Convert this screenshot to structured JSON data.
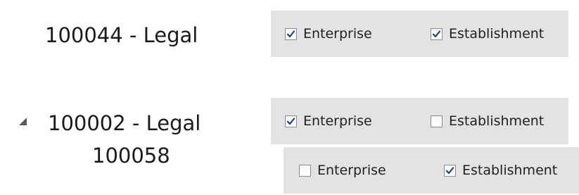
{
  "rows": [
    {
      "label": "100044 - Legal",
      "enterprise": {
        "label": "Enterprise",
        "checked": true
      },
      "establishment": {
        "label": "Establishment",
        "checked": true
      }
    },
    {
      "label": "100002 - Legal",
      "expander": "collapse-triangle-icon",
      "enterprise": {
        "label": "Enterprise",
        "checked": true
      },
      "establishment": {
        "label": "Establishment",
        "checked": false
      }
    },
    {
      "label": "100058",
      "enterprise": {
        "label": "Enterprise",
        "checked": false
      },
      "establishment": {
        "label": "Establishment",
        "checked": true
      }
    }
  ],
  "colors": {
    "panel_bg": "#e3e3e3",
    "check_mark": "#1d3f8e",
    "box_border": "#8c8c8c"
  }
}
